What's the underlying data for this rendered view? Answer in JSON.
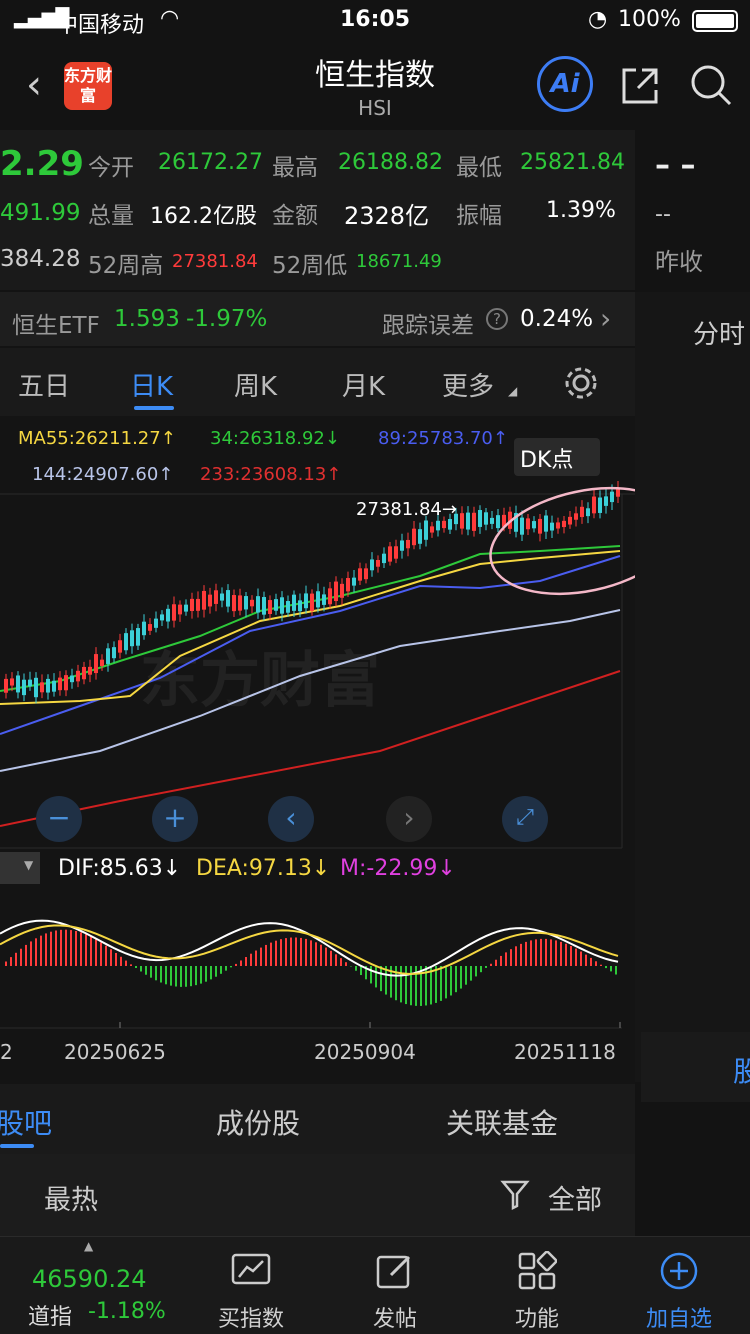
{
  "status_bar": {
    "carrier": "中国移动",
    "time": "16:05",
    "battery": "100%"
  },
  "header": {
    "title": "恒生指数",
    "subtitle": "HSI",
    "logo_text": "东方财富",
    "ai_label": "Ai"
  },
  "quote": {
    "price": "2.29",
    "change": "491.99",
    "prev": "384.28",
    "open_label": "今开",
    "open": "26172.27",
    "high_label": "最高",
    "high": "26188.82",
    "low_label": "最低",
    "low": "25821.84",
    "volume_label": "总量",
    "volume": "162.2亿股",
    "amount_label": "金额",
    "amount": "2328亿",
    "amplitude_label": "振幅",
    "amplitude": "1.39%",
    "wk52high_label": "52周高",
    "wk52high": "27381.84",
    "wk52low_label": "52周低",
    "wk52low": "18671.49"
  },
  "right_panel": {
    "dash1": "– –",
    "dash2": "--",
    "prev_close_label": "昨收",
    "tab": "分时",
    "tab2": "股"
  },
  "etf": {
    "name": "恒生ETF",
    "price": "1.593",
    "change": "-1.97%",
    "track_label": "跟踪误差",
    "track_value": "0.24%"
  },
  "tabs": [
    "五日",
    "日K",
    "周K",
    "月K",
    "更多"
  ],
  "ma": {
    "ma55": "MA55:26211.27↑",
    "ma34": "34:26318.92↓",
    "ma89": "89:25783.70↑",
    "ma144": "144:24907.60↑",
    "ma233": "233:23608.13↑",
    "dk": "DK点"
  },
  "peak_label": "27381.84→",
  "watermark": "东方财富",
  "macd": {
    "dif": "DIF:85.63↓",
    "dea": "DEA:97.13↓",
    "m": "M:-22.99↓"
  },
  "dates": [
    "2",
    "20250625",
    "20250904",
    "20251118"
  ],
  "bottom_tabs": [
    "股吧",
    "成份股",
    "关联基金"
  ],
  "sort": {
    "hot": "最热",
    "all": "全部"
  },
  "tabbar": {
    "index_value": "46590.24",
    "index_name": "道指",
    "index_change": "-1.18%",
    "items": [
      "买指数",
      "发帖",
      "功能",
      "加自选"
    ]
  },
  "colors": {
    "up": "#ff3b3b",
    "down": "#2ec93a",
    "accent": "#3d7df5",
    "ma55": "#f5d742",
    "ma34": "#2ec93a",
    "ma89": "#4a5df0",
    "ma144": "#b8c4e8",
    "ma233": "#d02020"
  }
}
